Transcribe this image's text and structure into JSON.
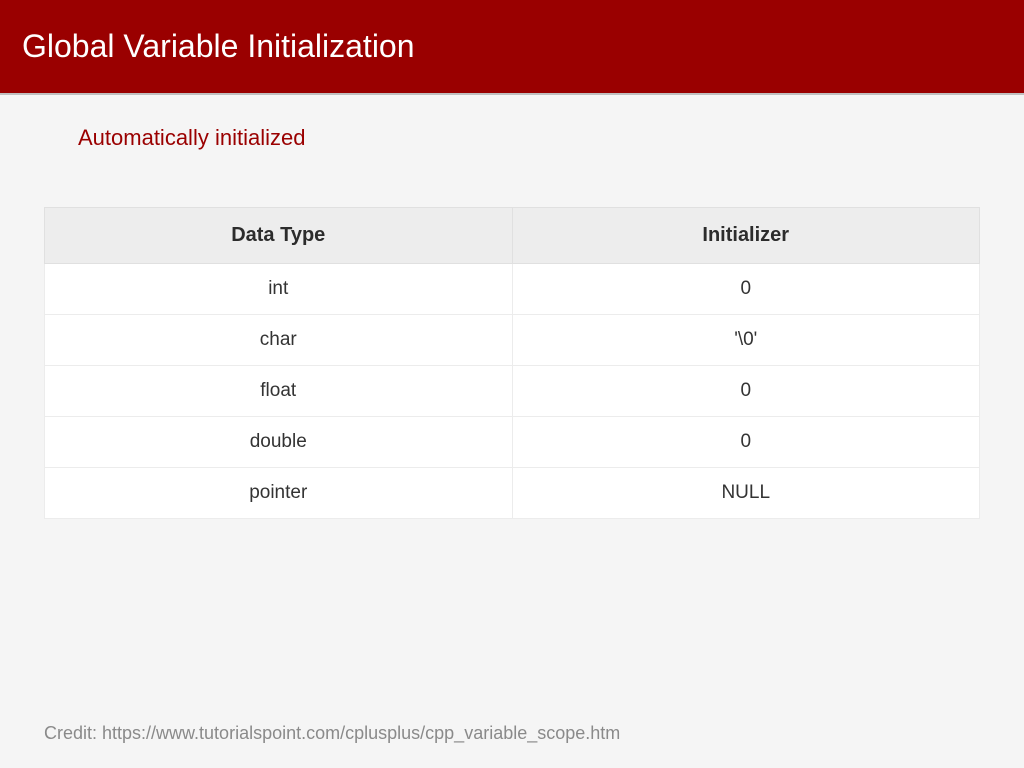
{
  "header": {
    "title": "Global Variable Initialization"
  },
  "subtitle": "Automatically initialized",
  "table": {
    "headers": [
      "Data Type",
      "Initializer"
    ],
    "rows": [
      {
        "type": "int",
        "init": "0"
      },
      {
        "type": "char",
        "init": "'\\0'"
      },
      {
        "type": "float",
        "init": "0"
      },
      {
        "type": "double",
        "init": "0"
      },
      {
        "type": "pointer",
        "init": "NULL"
      }
    ]
  },
  "credit": "Credit: https://www.tutorialspoint.com/cplusplus/cpp_variable_scope.htm"
}
